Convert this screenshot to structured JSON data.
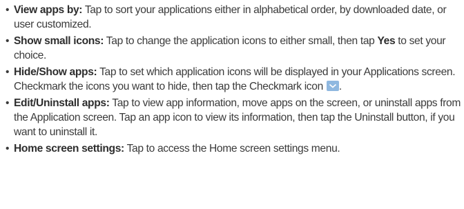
{
  "bullet_symbol": "•",
  "items": [
    {
      "term": "View apps by:",
      "text": " Tap to sort your applications either in alphabetical order, by downloaded date, or user customized."
    },
    {
      "term": "Show small icons:",
      "text_before": " Tap to change the application icons to either small, then tap ",
      "bold_word": "Yes",
      "text_after": " to set your choice."
    },
    {
      "term": "Hide/Show apps:",
      "text": " Tap to set which application icons will be displayed in your Applications screen. Checkmark the icons you want to hide, then tap the Checkmark icon ",
      "icon": "checkmark-icon",
      "icon_color": "#8fb8e0",
      "text_end": "."
    },
    {
      "term": "Edit/Uninstall apps:",
      "text": " Tap to view app information, move apps on the screen, or uninstall apps from the Application screen. Tap an app icon to view its information, then tap the Uninstall button, if you want to uninstall it."
    },
    {
      "term": "Home screen settings:",
      "text": " Tap to access the Home screen settings menu."
    }
  ]
}
